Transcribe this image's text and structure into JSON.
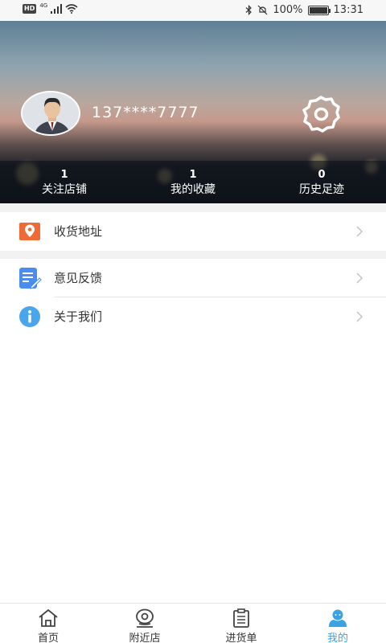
{
  "status_bar": {
    "network_badge": "HD",
    "network_type": "4G",
    "battery_text": "100%",
    "battery_level": 1.0,
    "time": "13:31",
    "icons": [
      "bluetooth-icon",
      "mute-icon",
      "signal-icon",
      "wifi-icon"
    ]
  },
  "profile": {
    "username": "137****7777",
    "avatar_icon": "user-avatar-icon",
    "settings_icon": "gear-icon"
  },
  "stats": [
    {
      "value": "1",
      "label": "关注店铺"
    },
    {
      "value": "1",
      "label": "我的收藏"
    },
    {
      "value": "0",
      "label": "历史足迹"
    }
  ],
  "menu": {
    "address": {
      "label": "收货地址",
      "icon": "location-pin-icon",
      "color": "#f06a35"
    },
    "feedback": {
      "label": "意见反馈",
      "icon": "document-edit-icon",
      "color": "#4a8cf0"
    },
    "about": {
      "label": "关于我们",
      "icon": "info-icon",
      "color": "#4aa6ec"
    }
  },
  "bottom_nav": [
    {
      "label": "首页",
      "icon": "home-icon",
      "active": false
    },
    {
      "label": "附近店",
      "icon": "location-icon",
      "active": false
    },
    {
      "label": "进货单",
      "icon": "clipboard-icon",
      "active": false
    },
    {
      "label": "我的",
      "icon": "profile-icon",
      "active": true
    }
  ],
  "colors": {
    "accent": "#3aa3e3",
    "text_primary": "#333333",
    "divider": "#e5e5e5"
  }
}
